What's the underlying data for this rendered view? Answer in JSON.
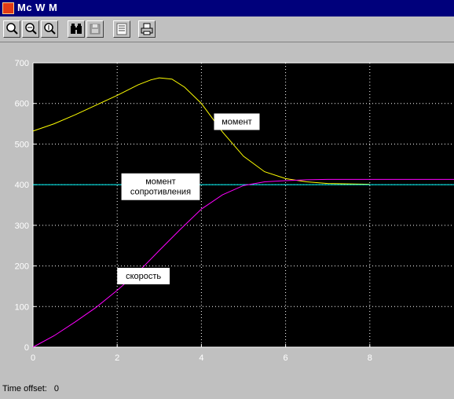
{
  "window": {
    "title": "Mc W M"
  },
  "toolbar": {
    "buttons": [
      {
        "icon": "zoom-in-icon"
      },
      {
        "icon": "zoom-x-icon"
      },
      {
        "icon": "zoom-y-icon"
      },
      {
        "icon": "binoculars-icon"
      },
      {
        "icon": "save-axes-icon"
      },
      {
        "icon": "parameters-icon"
      },
      {
        "icon": "print-icon"
      }
    ]
  },
  "chart_data": {
    "type": "line",
    "xlim": [
      0,
      10
    ],
    "ylim": [
      0,
      700
    ],
    "xticks": [
      0,
      2,
      4,
      6,
      8
    ],
    "yticks": [
      0,
      100,
      200,
      300,
      400,
      500,
      600,
      700
    ],
    "grid": true,
    "series": [
      {
        "color": "#ffff00",
        "x": [
          0,
          0.5,
          1,
          1.5,
          2,
          2.5,
          2.8,
          3.0,
          3.3,
          3.6,
          4.0,
          4.5,
          5.0,
          5.5,
          6.0,
          6.5,
          7.0,
          7.5,
          8.0
        ],
        "y": [
          532,
          550,
          572,
          596,
          620,
          646,
          658,
          663,
          660,
          640,
          600,
          530,
          470,
          432,
          415,
          407,
          403,
          402,
          401
        ]
      },
      {
        "color": "#00ffff",
        "x": [
          0,
          10
        ],
        "y": [
          400,
          400
        ]
      },
      {
        "color": "#ff00ff",
        "x": [
          0,
          0.5,
          1,
          1.5,
          2,
          2.5,
          3,
          3.5,
          4,
          4.5,
          5,
          5.5,
          6,
          6.5,
          7,
          7.5,
          8,
          9,
          10
        ],
        "y": [
          0,
          28,
          62,
          98,
          140,
          185,
          238,
          290,
          340,
          375,
          398,
          407,
          410,
          412,
          413,
          413,
          413,
          413,
          413
        ]
      }
    ],
    "annotations": [
      {
        "text": "момент",
        "x": 4.3,
        "y": 555
      },
      {
        "text": "момент сопротивления",
        "x": 2.1,
        "y": 395
      },
      {
        "text": "скорость",
        "x": 2.0,
        "y": 175
      }
    ]
  },
  "status": {
    "label": "Time offset:",
    "value": "0"
  }
}
